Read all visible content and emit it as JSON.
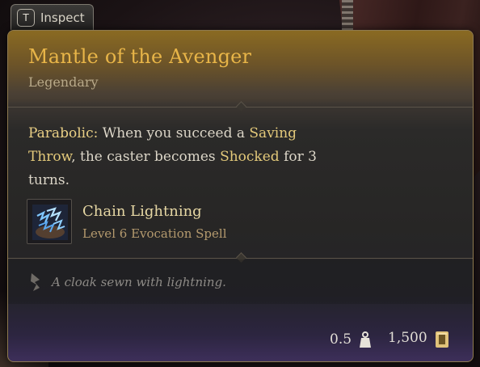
{
  "inspect": {
    "key": "T",
    "label": "Inspect"
  },
  "item": {
    "name": "Mantle of the Avenger",
    "rarity": "Legendary",
    "description": {
      "keyword": "Parabolic:",
      "part1": " When you succeed a ",
      "term1": "Saving Throw",
      "part2": ", the caster becomes ",
      "term2": "Shocked",
      "part3": " for 3 turns."
    },
    "spell": {
      "name": "Chain Lightning",
      "level": "Level 6 Evocation Spell",
      "icon": "chain-lightning-icon"
    },
    "flavor": "A cloak sewn with lightning.",
    "weight": "0.5",
    "value": "1,500"
  },
  "colors": {
    "title": "#e8b548",
    "keyword": "#e9cf85",
    "spell_name": "#e6d7a4",
    "spell_level": "#b49a6e",
    "flavor": "#8d8a86"
  }
}
